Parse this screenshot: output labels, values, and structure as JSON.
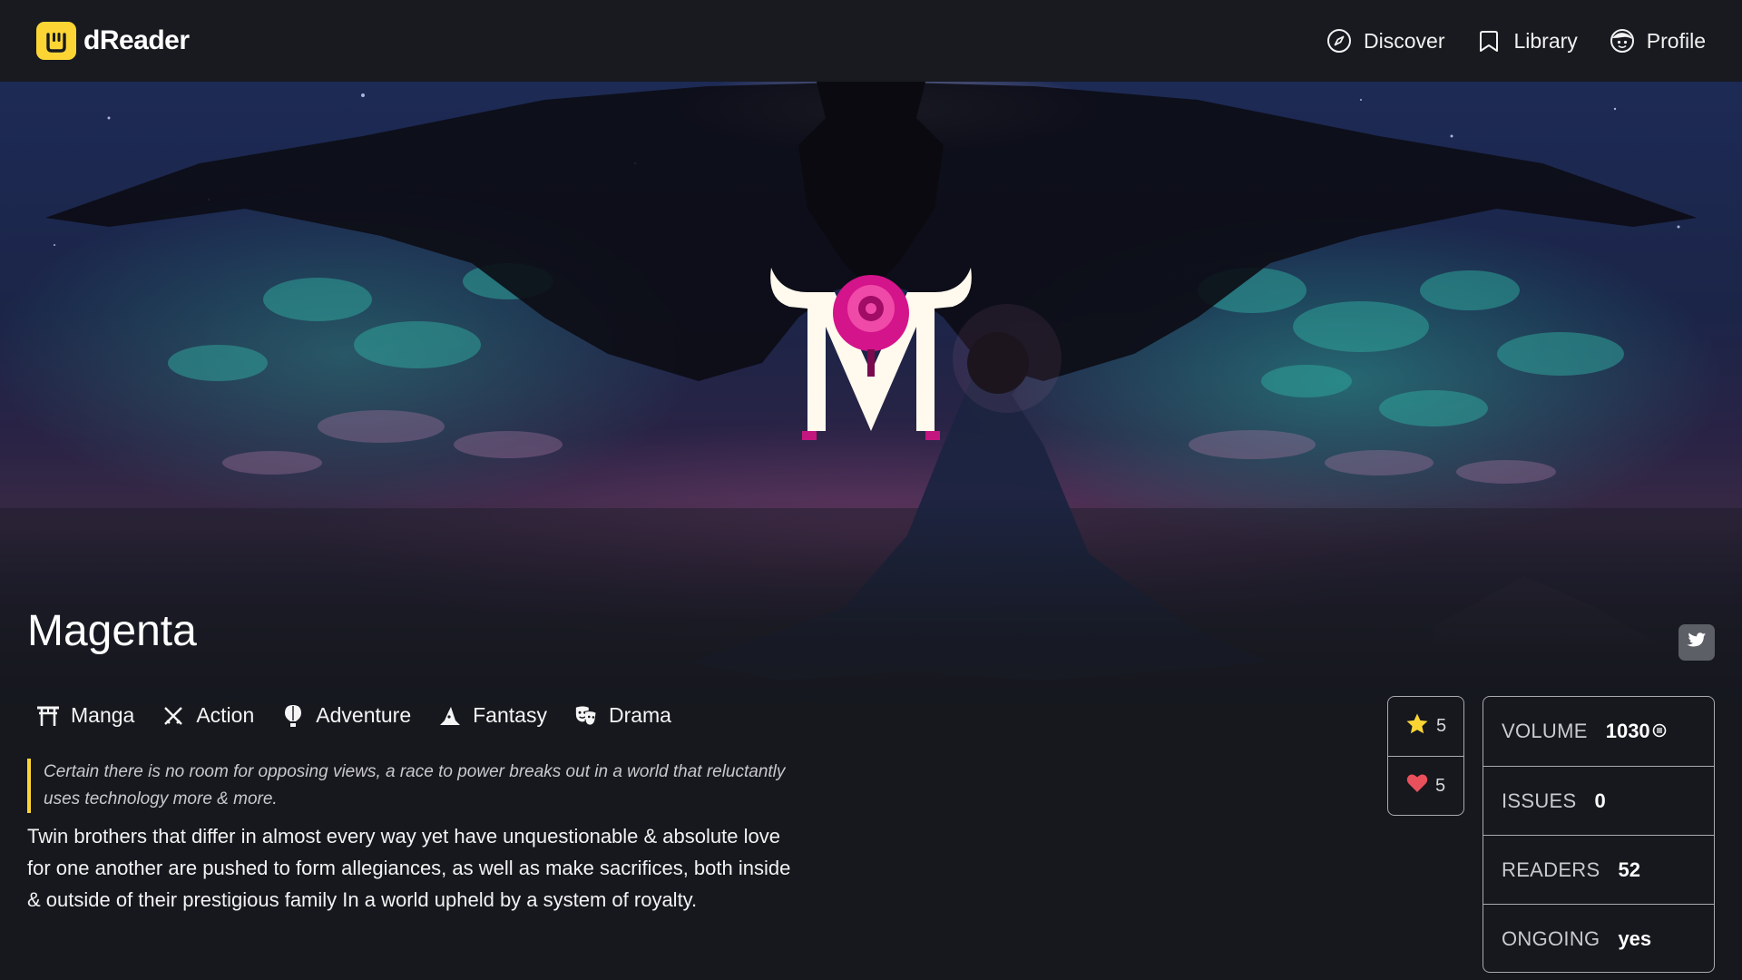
{
  "app": {
    "name": "dReader",
    "logo_icon": "dreader-logo-icon",
    "accent": "#fcd535"
  },
  "nav": {
    "items": [
      {
        "label": "Discover",
        "icon": "compass-icon"
      },
      {
        "label": "Library",
        "icon": "bookmark-icon"
      },
      {
        "label": "Profile",
        "icon": "avatar-face-icon"
      }
    ]
  },
  "comic": {
    "title": "Magenta",
    "genres": [
      {
        "label": "Manga",
        "icon": "torii-gate-icon"
      },
      {
        "label": "Action",
        "icon": "crossed-swords-icon"
      },
      {
        "label": "Adventure",
        "icon": "hot-air-balloon-icon"
      },
      {
        "label": "Fantasy",
        "icon": "wizard-hat-icon"
      },
      {
        "label": "Drama",
        "icon": "theater-masks-icon"
      }
    ],
    "tagline": "Certain there is no room for opposing views, a race to power breaks out in a world that reluctantly uses technology more & more.",
    "description": "Twin brothers that differ in almost every way yet have unquestionable & absolute love for one another are pushed to form allegiances, as well as make sacrifices, both inside & outside of their prestigious family In a world upheld by a system of royalty.",
    "social": {
      "twitter_icon": "twitter-icon"
    }
  },
  "ratings": {
    "stars": {
      "icon": "star-icon",
      "value": "5",
      "color": "#fcd535"
    },
    "favorites": {
      "icon": "heart-icon",
      "value": "5",
      "color": "#e8505b"
    }
  },
  "stats": [
    {
      "label": "VOLUME",
      "value": "1030",
      "icon": "currency-coin-icon"
    },
    {
      "label": "ISSUES",
      "value": "0"
    },
    {
      "label": "READERS",
      "value": "52"
    },
    {
      "label": "ONGOING",
      "value": "yes"
    }
  ],
  "cover_logo": {
    "letter": "M",
    "rose_color": "#d4148a"
  }
}
